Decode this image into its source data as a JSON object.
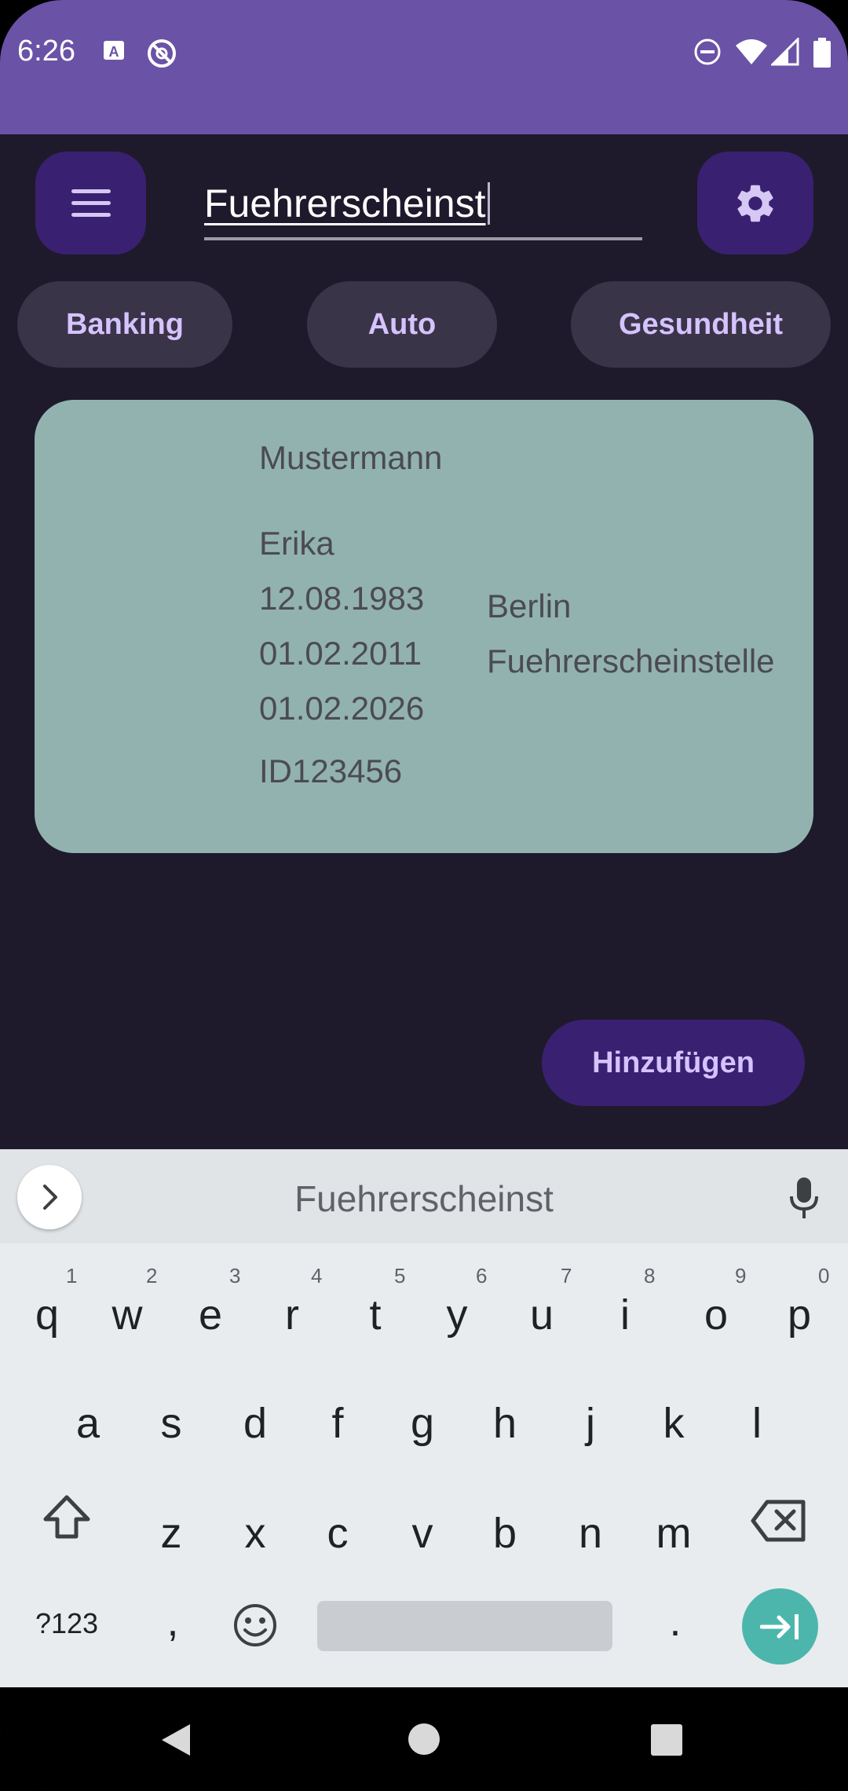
{
  "status_bar": {
    "time": "6:26",
    "left_icons": [
      "keyboard-a-icon",
      "data-saver-icon"
    ],
    "right_icons": [
      "do-not-disturb-icon",
      "wifi-icon",
      "cell-signal-icon",
      "battery-icon"
    ],
    "background": "#6a52a6"
  },
  "app_bar": {
    "search_value": "Fuehrerscheinst",
    "menu_icon": "menu-icon",
    "settings_icon": "gear-icon"
  },
  "categories": [
    {
      "label": "Banking"
    },
    {
      "label": "Auto"
    },
    {
      "label": "Gesundheit"
    }
  ],
  "card": {
    "surname": "Mustermann",
    "given_name": "Erika",
    "birth_date": "12.08.1983",
    "issue_date": "01.02.2011",
    "expiry_date": "01.02.2026",
    "id_number": "ID123456",
    "city": "Berlin",
    "authority": "Fuehrerscheinstelle",
    "background": "#92b2b0"
  },
  "add_button": {
    "label": "Hinzufügen"
  },
  "keyboard": {
    "suggestion": "Fuehrerscheinst",
    "row1": [
      {
        "key": "q",
        "hint": "1"
      },
      {
        "key": "w",
        "hint": "2"
      },
      {
        "key": "e",
        "hint": "3"
      },
      {
        "key": "r",
        "hint": "4"
      },
      {
        "key": "t",
        "hint": "5"
      },
      {
        "key": "y",
        "hint": "6"
      },
      {
        "key": "u",
        "hint": "7"
      },
      {
        "key": "i",
        "hint": "8"
      },
      {
        "key": "o",
        "hint": "9"
      },
      {
        "key": "p",
        "hint": "0"
      }
    ],
    "row2": [
      "a",
      "s",
      "d",
      "f",
      "g",
      "h",
      "j",
      "k",
      "l"
    ],
    "row3": [
      "z",
      "x",
      "c",
      "v",
      "b",
      "n",
      "m"
    ],
    "symbols_label": "?123",
    "comma": ",",
    "period": ".",
    "accent": "#4db6ac"
  },
  "nav_bar": {
    "icons": [
      "back-icon",
      "home-icon",
      "recents-icon"
    ]
  }
}
